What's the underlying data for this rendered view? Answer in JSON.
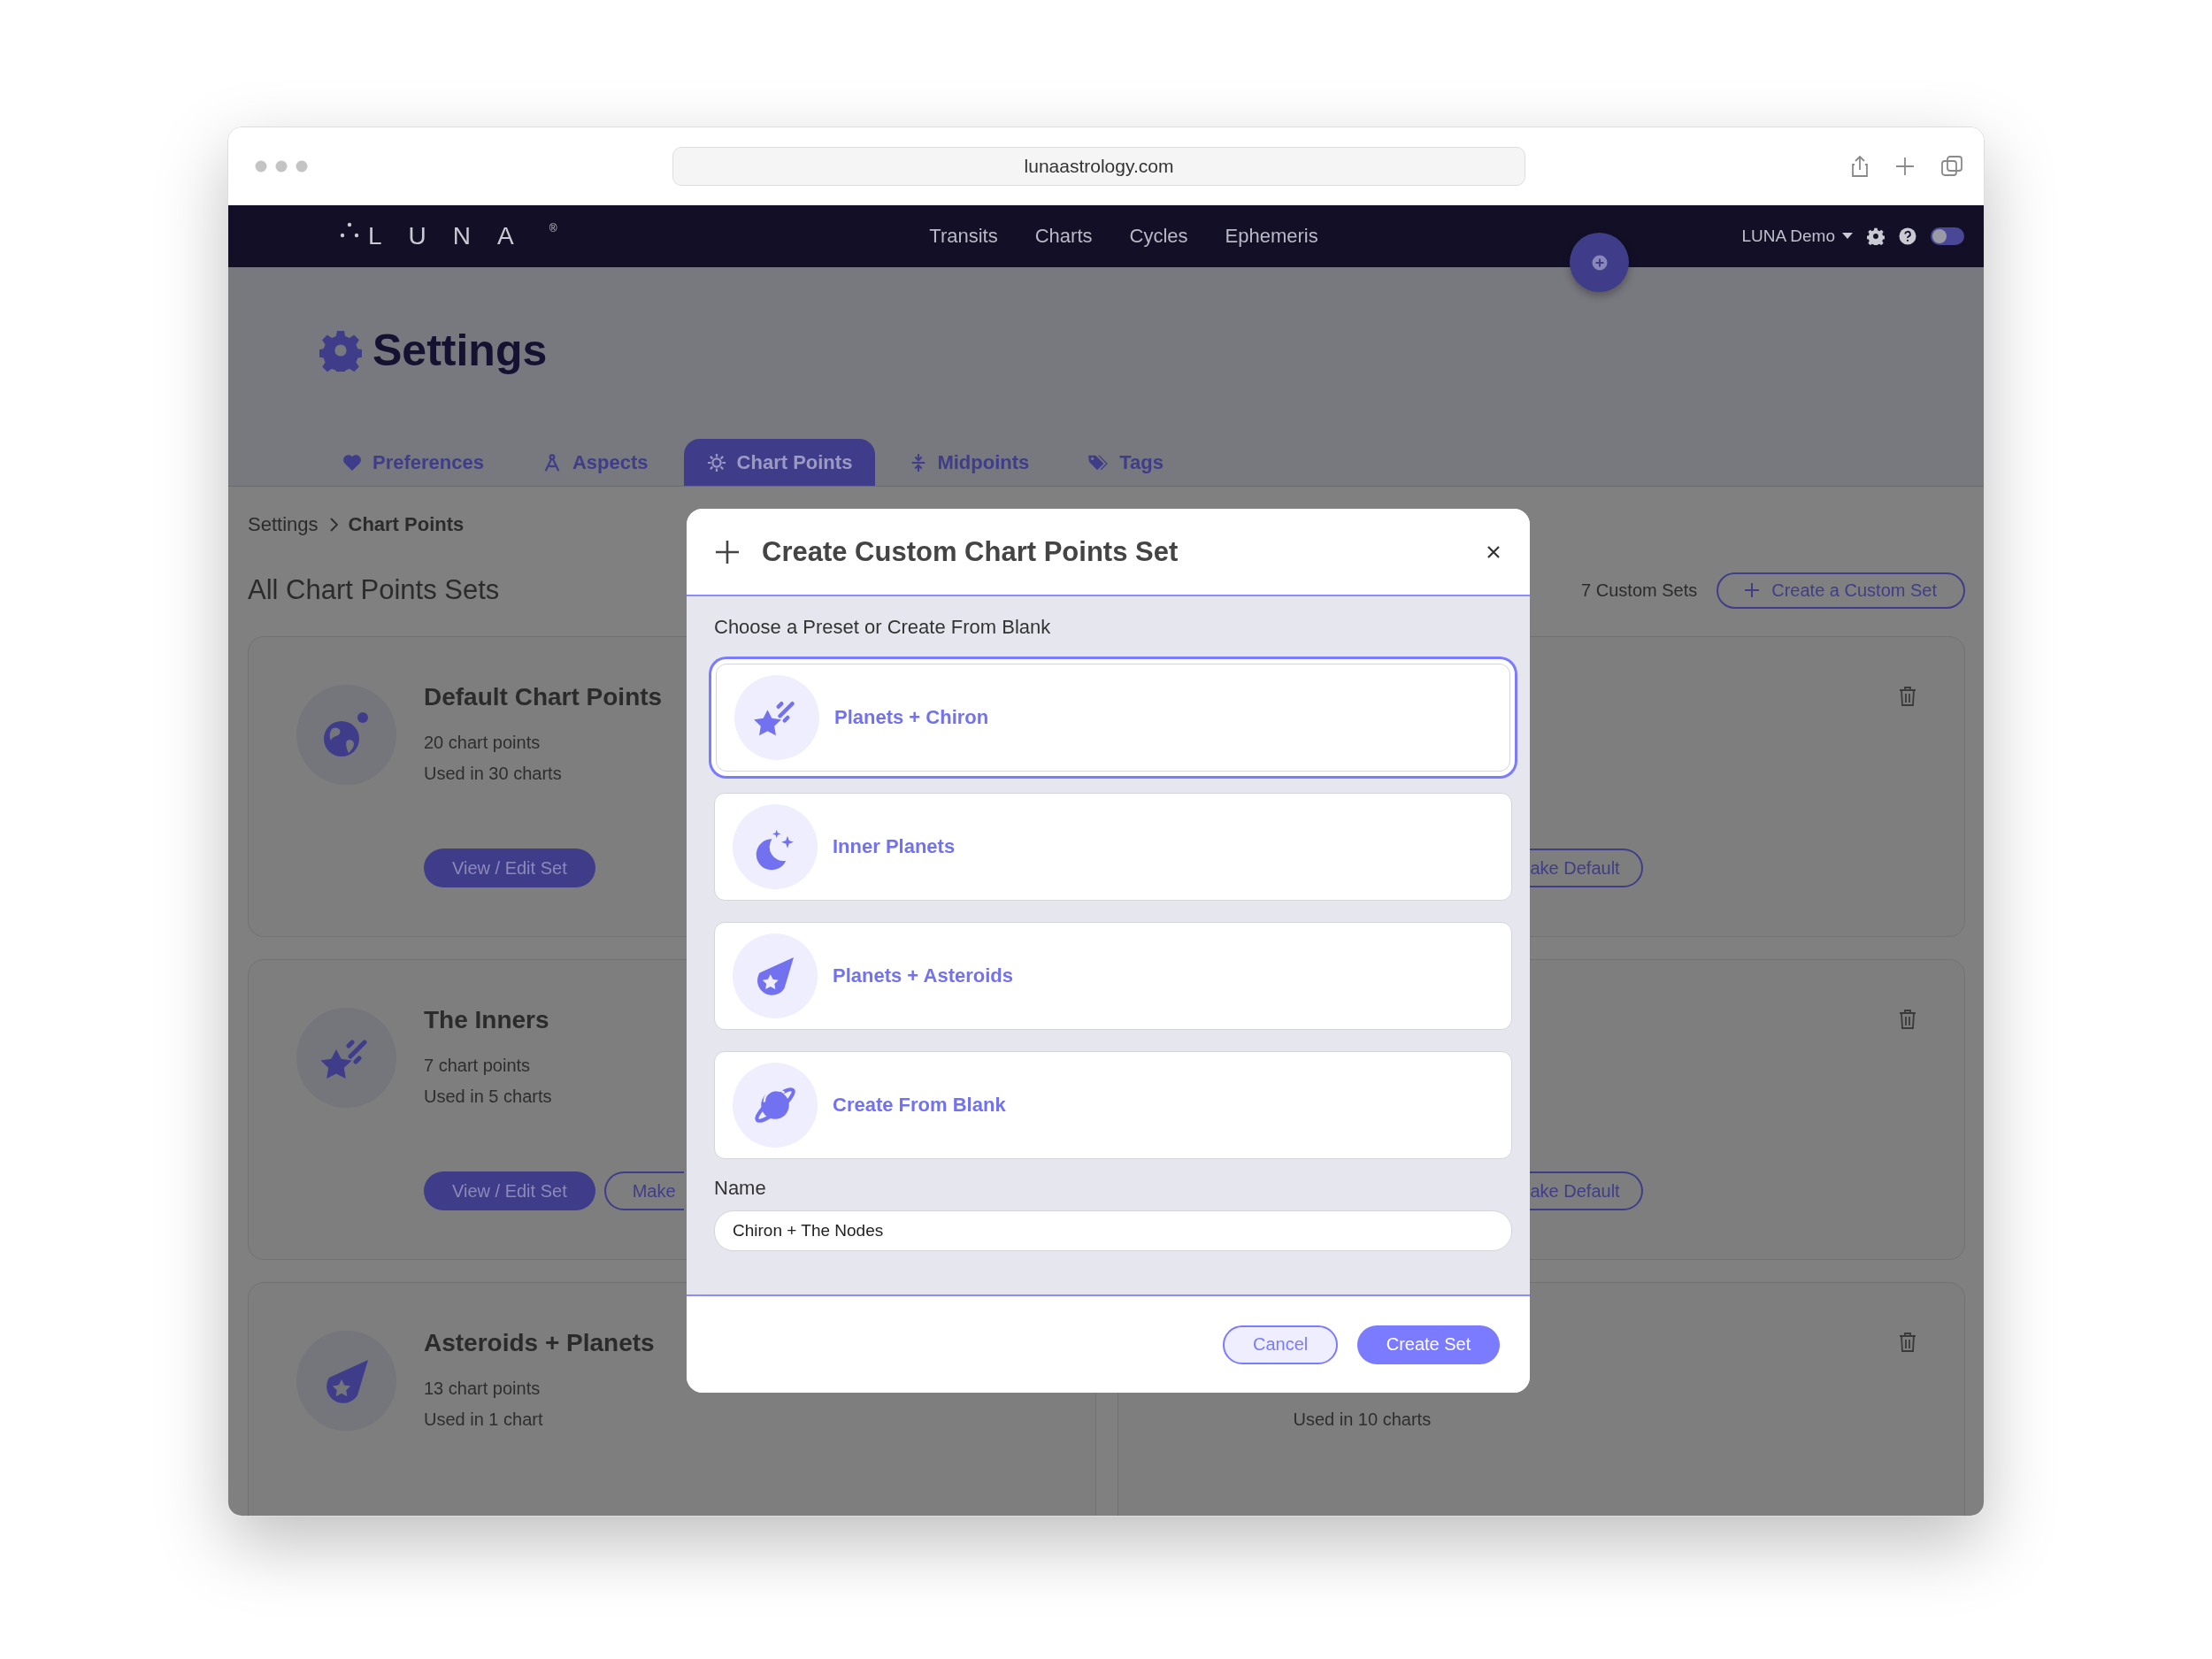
{
  "browser": {
    "url": "lunaastrology.com"
  },
  "nav": {
    "logo": "LUNA",
    "logo_mark": "®",
    "links": [
      "Transits",
      "Charts",
      "Cycles",
      "Ephemeris"
    ],
    "account": "LUNA Demo",
    "theme_toggle": {
      "on": false
    }
  },
  "header": {
    "title": "Settings",
    "tabs": [
      {
        "label": "Preferences",
        "selected": false
      },
      {
        "label": "Aspects",
        "selected": false
      },
      {
        "label": "Chart Points",
        "selected": true
      },
      {
        "label": "Midpoints",
        "selected": false
      },
      {
        "label": "Tags",
        "selected": false
      }
    ]
  },
  "breadcrumb": [
    "Settings",
    "Chart Points"
  ],
  "section": {
    "title": "All Chart Points Sets",
    "count": "7 Custom Sets",
    "create_button": "Create a Custom Set"
  },
  "left_cards": [
    {
      "title": "Default Chart Points",
      "points": "20 chart points",
      "used": "Used in 30 charts",
      "buttons": [
        {
          "label": "View / Edit Set",
          "kind": "filled"
        }
      ]
    },
    {
      "title": "The Inners",
      "points": "7 chart points",
      "used": "Used in 5 charts",
      "buttons": [
        {
          "label": "View / Edit Set",
          "kind": "filled"
        },
        {
          "label": "Make",
          "kind": "partial"
        }
      ]
    },
    {
      "title": "Asteroids + Planets",
      "points": "13 chart points",
      "used": "Used in 1 chart"
    }
  ],
  "right_cards": [
    {
      "buttons": [
        {
          "label": "ake Default",
          "kind": "partial"
        }
      ]
    },
    {
      "buttons": [
        {
          "label": "ake Default",
          "kind": "partial"
        }
      ]
    },
    {
      "used": "Used in 10 charts"
    }
  ],
  "modal": {
    "title": "Create Custom Chart Points Set",
    "prompt": "Choose a Preset or Create From Blank",
    "options": [
      {
        "label": "Planets + Chiron",
        "selected": true
      },
      {
        "label": "Inner Planets",
        "selected": false
      },
      {
        "label": "Planets + Asteroids",
        "selected": false
      },
      {
        "label": "Create From Blank",
        "selected": false
      }
    ],
    "name_label": "Name",
    "name_value": "Chiron + The Nodes",
    "buttons": [
      {
        "label": "Cancel",
        "kind": "outline"
      },
      {
        "label": "Create Set",
        "kind": "primary"
      }
    ]
  }
}
